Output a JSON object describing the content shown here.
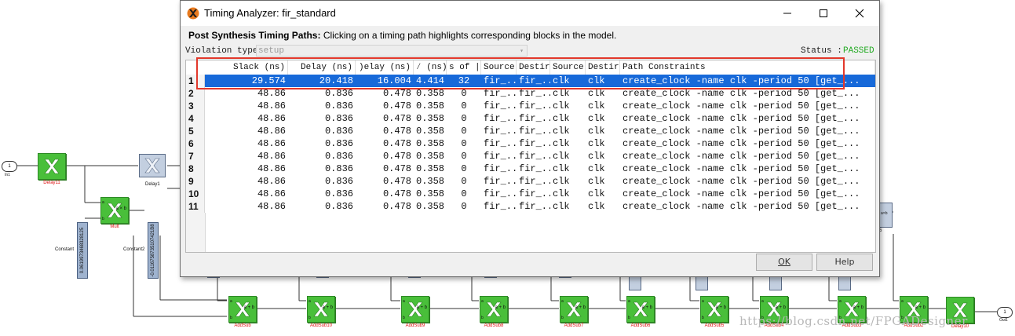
{
  "window": {
    "title": "Timing Analyzer: fir_standard"
  },
  "info": {
    "bold": "Post Synthesis Timing Paths:",
    "text": " Clicking on a timing path highlights corresponding blocks in the model."
  },
  "violation": {
    "label": "Violation type",
    "value": "setup"
  },
  "status": {
    "label": "Status :",
    "value": "PASSED",
    "color": "#22aa22"
  },
  "table": {
    "columns": [
      "Slack (ns)",
      "Delay (ns)",
      ")elay (ns)",
      "⁄ (ns)",
      "s of |",
      "Source",
      "Destir",
      "Source",
      "Destir",
      "Path Constraints"
    ],
    "rows": [
      {
        "n": "1",
        "slack": "29.574",
        "delay": "20.418",
        "d2": "16.004",
        "d3": "4.414",
        "lv": "32",
        "src": "fir_...",
        "dst": "fir_...",
        "sclk": "clk",
        "dclk": "clk",
        "pc": "create_clock -name clk -period 50 [get_..."
      },
      {
        "n": "2",
        "slack": "48.86",
        "delay": "0.836",
        "d2": "0.478",
        "d3": "0.358",
        "lv": "0",
        "src": "fir_...",
        "dst": "fir_...",
        "sclk": "clk",
        "dclk": "clk",
        "pc": "create_clock -name clk -period 50 [get_..."
      },
      {
        "n": "3",
        "slack": "48.86",
        "delay": "0.836",
        "d2": "0.478",
        "d3": "0.358",
        "lv": "0",
        "src": "fir_...",
        "dst": "fir_...",
        "sclk": "clk",
        "dclk": "clk",
        "pc": "create_clock -name clk -period 50 [get_..."
      },
      {
        "n": "4",
        "slack": "48.86",
        "delay": "0.836",
        "d2": "0.478",
        "d3": "0.358",
        "lv": "0",
        "src": "fir_...",
        "dst": "fir_...",
        "sclk": "clk",
        "dclk": "clk",
        "pc": "create_clock -name clk -period 50 [get_..."
      },
      {
        "n": "5",
        "slack": "48.86",
        "delay": "0.836",
        "d2": "0.478",
        "d3": "0.358",
        "lv": "0",
        "src": "fir_...",
        "dst": "fir_...",
        "sclk": "clk",
        "dclk": "clk",
        "pc": "create_clock -name clk -period 50 [get_..."
      },
      {
        "n": "6",
        "slack": "48.86",
        "delay": "0.836",
        "d2": "0.478",
        "d3": "0.358",
        "lv": "0",
        "src": "fir_...",
        "dst": "fir_...",
        "sclk": "clk",
        "dclk": "clk",
        "pc": "create_clock -name clk -period 50 [get_..."
      },
      {
        "n": "7",
        "slack": "48.86",
        "delay": "0.836",
        "d2": "0.478",
        "d3": "0.358",
        "lv": "0",
        "src": "fir_...",
        "dst": "fir_...",
        "sclk": "clk",
        "dclk": "clk",
        "pc": "create_clock -name clk -period 50 [get_..."
      },
      {
        "n": "8",
        "slack": "48.86",
        "delay": "0.836",
        "d2": "0.478",
        "d3": "0.358",
        "lv": "0",
        "src": "fir_...",
        "dst": "fir_...",
        "sclk": "clk",
        "dclk": "clk",
        "pc": "create_clock -name clk -period 50 [get_..."
      },
      {
        "n": "9",
        "slack": "48.86",
        "delay": "0.836",
        "d2": "0.478",
        "d3": "0.358",
        "lv": "0",
        "src": "fir_...",
        "dst": "fir_...",
        "sclk": "clk",
        "dclk": "clk",
        "pc": "create_clock -name clk -period 50 [get_..."
      },
      {
        "n": "10",
        "slack": "48.86",
        "delay": "0.836",
        "d2": "0.478",
        "d3": "0.358",
        "lv": "0",
        "src": "fir_...",
        "dst": "fir_...",
        "sclk": "clk",
        "dclk": "clk",
        "pc": "create_clock -name clk -period 50 [get_..."
      },
      {
        "n": "11",
        "slack": "48.86",
        "delay": "0.836",
        "d2": "0.478",
        "d3": "0.358",
        "lv": "0",
        "src": "fir_...",
        "dst": "fir_...",
        "sclk": "clk",
        "dclk": "clk",
        "pc": "create_clock -name clk -period 50 [get_..."
      }
    ]
  },
  "buttons": {
    "ok": "OK",
    "help": "Help"
  },
  "model": {
    "in_port": "1",
    "in_label": "In1",
    "out_port": "1",
    "out_label": "Out1",
    "delay11": "Delay11",
    "delay1": "Delay1",
    "mult": "Mult",
    "constant": "Constant",
    "constant2": "Constant2",
    "const1_value": "0.0619973468328125",
    "const2_value": "-0.0116758735107421B8",
    "adds": [
      "AddSub",
      "AddSub10",
      "AddSub9",
      "AddSub8",
      "AddSub7",
      "AddSub6",
      "AddSub5",
      "AddSub4",
      "AddSub3",
      "AddSub2"
    ],
    "delay10": "Delay10",
    "mult5": "5"
  },
  "watermark": "https://blog.csdn.net/FPGADesigner"
}
